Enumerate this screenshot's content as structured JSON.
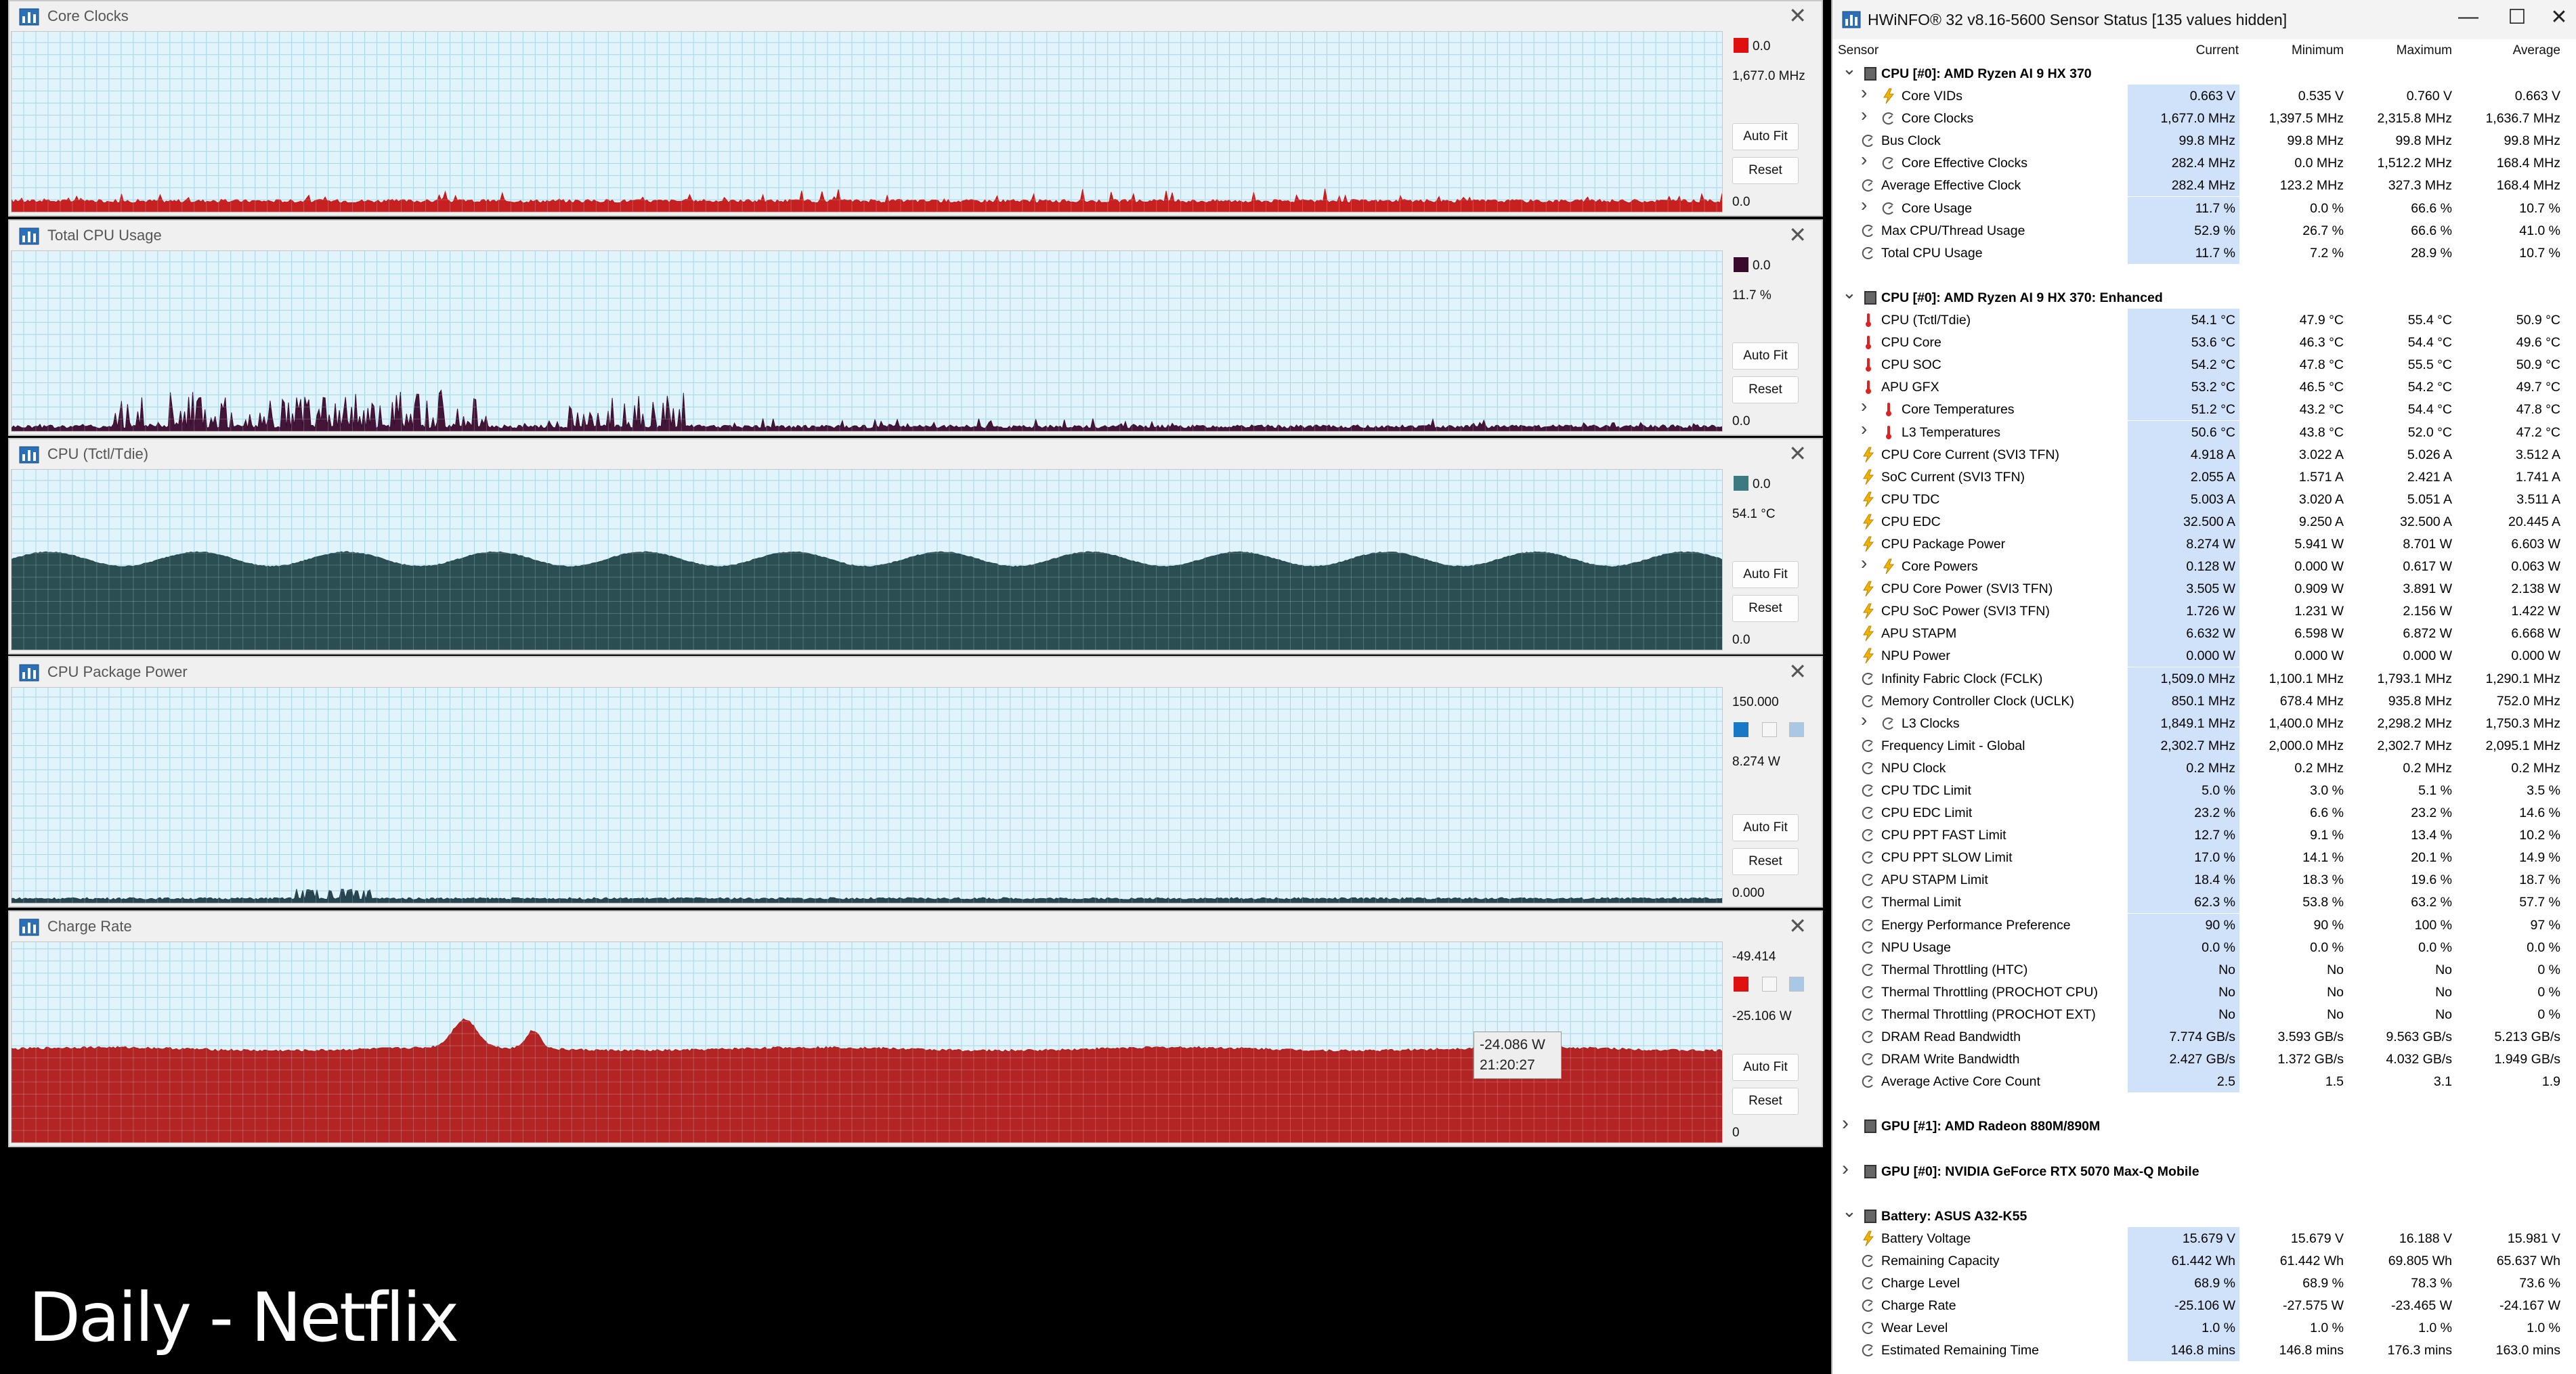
{
  "graphs": [
    {
      "id": "core-clocks",
      "title": "Core Clocks",
      "top_label": "0.0",
      "value_label": "1,677.0 MHz",
      "bottom_label": "0.0",
      "color": "#c41414",
      "swatch_color": "#e01010",
      "series_level": 0.055,
      "pattern": "spiky"
    },
    {
      "id": "total-cpu-usage",
      "title": "Total CPU Usage",
      "top_label": "0.0",
      "value_label": "11.7 %",
      "bottom_label": "0.0",
      "color": "#3a0a2e",
      "swatch_color": "#3a0a2e",
      "series_level": 0.03,
      "pattern": "usage"
    },
    {
      "id": "cpu-tctl",
      "title": "CPU (Tctl/Tdie)",
      "top_label": "0.0",
      "value_label": "54.1 °C",
      "bottom_label": "0.0",
      "color": "#21454a",
      "swatch_color": "#3a7a80",
      "series_level": 0.5,
      "pattern": "wave"
    },
    {
      "id": "cpu-package-power",
      "title": "CPU Package Power",
      "top_label": "150.000",
      "value_label": "8.274 W",
      "bottom_label": "0.000",
      "color": "#1e3a48",
      "swatch_color": "#1878c8",
      "series_level": 0.02,
      "pattern": "flat"
    },
    {
      "id": "charge-rate",
      "title": "Charge Rate",
      "top_label": "-49.414",
      "value_label": "-25.106 W",
      "bottom_label": "0",
      "color": "#b01818",
      "swatch_color": "#e01010",
      "series_level": 0.48,
      "pattern": "charge"
    }
  ],
  "graph_buttons": {
    "autofit": "Auto Fit",
    "reset": "Reset"
  },
  "tooltip": {
    "value": "-24.086 W",
    "time": "21:20:27"
  },
  "overlay_title": "Daily - Netflix",
  "sensor_window": {
    "title": "HWiNFO® 32 v8.16-5600 Sensor Status [135 values hidden]",
    "columns": {
      "sensor": "Sensor",
      "current": "Current",
      "minimum": "Minimum",
      "maximum": "Maximum",
      "average": "Average"
    },
    "rows": [
      {
        "type": "group",
        "name": "CPU [#0]: AMD Ryzen AI 9 HX 370",
        "expanded": true
      },
      {
        "type": "item",
        "icon": "bolt",
        "expand": true,
        "name": "Core VIDs",
        "cur": "0.663 V",
        "min": "0.535 V",
        "max": "0.760 V",
        "avg": "0.663 V"
      },
      {
        "type": "item",
        "icon": "clock",
        "expand": true,
        "name": "Core Clocks",
        "cur": "1,677.0 MHz",
        "min": "1,397.5 MHz",
        "max": "2,315.8 MHz",
        "avg": "1,636.7 MHz"
      },
      {
        "type": "item",
        "icon": "none",
        "expand": false,
        "name": "Bus Clock",
        "cur": "99.8 MHz",
        "min": "99.8 MHz",
        "max": "99.8 MHz",
        "avg": "99.8 MHz"
      },
      {
        "type": "item",
        "icon": "clock",
        "expand": true,
        "name": "Core Effective Clocks",
        "cur": "282.4 MHz",
        "min": "0.0 MHz",
        "max": "1,512.2 MHz",
        "avg": "168.4 MHz"
      },
      {
        "type": "item",
        "icon": "none",
        "expand": false,
        "name": "Average Effective Clock",
        "cur": "282.4 MHz",
        "min": "123.2 MHz",
        "max": "327.3 MHz",
        "avg": "168.4 MHz"
      },
      {
        "type": "item",
        "icon": "clock",
        "expand": true,
        "name": "Core Usage",
        "cur": "11.7 %",
        "min": "0.0 %",
        "max": "66.6 %",
        "avg": "10.7 %"
      },
      {
        "type": "item",
        "icon": "clock",
        "expand": false,
        "name": "Max CPU/Thread Usage",
        "cur": "52.9 %",
        "min": "26.7 %",
        "max": "66.6 %",
        "avg": "41.0 %"
      },
      {
        "type": "item",
        "icon": "clock",
        "expand": false,
        "name": "Total CPU Usage",
        "cur": "11.7 %",
        "min": "7.2 %",
        "max": "28.9 %",
        "avg": "10.7 %"
      },
      {
        "type": "spacer"
      },
      {
        "type": "group",
        "name": "CPU [#0]: AMD Ryzen AI 9 HX 370: Enhanced",
        "expanded": true
      },
      {
        "type": "item",
        "icon": "temp",
        "expand": false,
        "name": "CPU (Tctl/Tdie)",
        "cur": "54.1 °C",
        "min": "47.9 °C",
        "max": "55.4 °C",
        "avg": "50.9 °C"
      },
      {
        "type": "item",
        "icon": "temp",
        "expand": false,
        "name": "CPU Core",
        "cur": "53.6 °C",
        "min": "46.3 °C",
        "max": "54.4 °C",
        "avg": "49.6 °C"
      },
      {
        "type": "item",
        "icon": "temp",
        "expand": false,
        "name": "CPU SOC",
        "cur": "54.2 °C",
        "min": "47.8 °C",
        "max": "55.5 °C",
        "avg": "50.9 °C"
      },
      {
        "type": "item",
        "icon": "temp",
        "expand": false,
        "name": "APU GFX",
        "cur": "53.2 °C",
        "min": "46.5 °C",
        "max": "54.2 °C",
        "avg": "49.7 °C"
      },
      {
        "type": "item",
        "icon": "temp",
        "expand": true,
        "name": "Core Temperatures",
        "cur": "51.2 °C",
        "min": "43.2 °C",
        "max": "54.4 °C",
        "avg": "47.8 °C"
      },
      {
        "type": "item",
        "icon": "temp",
        "expand": true,
        "name": "L3 Temperatures",
        "cur": "50.6 °C",
        "min": "43.8 °C",
        "max": "52.0 °C",
        "avg": "47.2 °C"
      },
      {
        "type": "item",
        "icon": "bolt",
        "expand": false,
        "name": "CPU Core Current (SVI3 TFN)",
        "cur": "4.918 A",
        "min": "3.022 A",
        "max": "5.026 A",
        "avg": "3.512 A"
      },
      {
        "type": "item",
        "icon": "bolt",
        "expand": false,
        "name": "SoC Current (SVI3 TFN)",
        "cur": "2.055 A",
        "min": "1.571 A",
        "max": "2.421 A",
        "avg": "1.741 A"
      },
      {
        "type": "item",
        "icon": "bolt",
        "expand": false,
        "name": "CPU TDC",
        "cur": "5.003 A",
        "min": "3.020 A",
        "max": "5.051 A",
        "avg": "3.511 A"
      },
      {
        "type": "item",
        "icon": "bolt",
        "expand": false,
        "name": "CPU EDC",
        "cur": "32.500 A",
        "min": "9.250 A",
        "max": "32.500 A",
        "avg": "20.445 A"
      },
      {
        "type": "item",
        "icon": "bolt",
        "expand": false,
        "name": "CPU Package Power",
        "cur": "8.274 W",
        "min": "5.941 W",
        "max": "8.701 W",
        "avg": "6.603 W"
      },
      {
        "type": "item",
        "icon": "bolt",
        "expand": true,
        "name": "Core Powers",
        "cur": "0.128 W",
        "min": "0.000 W",
        "max": "0.617 W",
        "avg": "0.063 W"
      },
      {
        "type": "item",
        "icon": "bolt",
        "expand": false,
        "name": "CPU Core Power (SVI3 TFN)",
        "cur": "3.505 W",
        "min": "0.909 W",
        "max": "3.891 W",
        "avg": "2.138 W"
      },
      {
        "type": "item",
        "icon": "bolt",
        "expand": false,
        "name": "CPU SoC Power (SVI3 TFN)",
        "cur": "1.726 W",
        "min": "1.231 W",
        "max": "2.156 W",
        "avg": "1.422 W"
      },
      {
        "type": "item",
        "icon": "bolt",
        "expand": false,
        "name": "APU STAPM",
        "cur": "6.632 W",
        "min": "6.598 W",
        "max": "6.872 W",
        "avg": "6.668 W"
      },
      {
        "type": "item",
        "icon": "bolt",
        "expand": false,
        "name": "NPU Power",
        "cur": "0.000 W",
        "min": "0.000 W",
        "max": "0.000 W",
        "avg": "0.000 W"
      },
      {
        "type": "item",
        "icon": "clock",
        "expand": false,
        "name": "Infinity Fabric Clock (FCLK)",
        "cur": "1,509.0 MHz",
        "min": "1,100.1 MHz",
        "max": "1,793.1 MHz",
        "avg": "1,290.1 MHz"
      },
      {
        "type": "item",
        "icon": "clock",
        "expand": false,
        "name": "Memory Controller Clock (UCLK)",
        "cur": "850.1 MHz",
        "min": "678.4 MHz",
        "max": "935.8 MHz",
        "avg": "752.0 MHz"
      },
      {
        "type": "item",
        "icon": "clock",
        "expand": true,
        "name": "L3 Clocks",
        "cur": "1,849.1 MHz",
        "min": "1,400.0 MHz",
        "max": "2,298.2 MHz",
        "avg": "1,750.3 MHz"
      },
      {
        "type": "item",
        "icon": "clock",
        "expand": false,
        "name": "Frequency Limit - Global",
        "cur": "2,302.7 MHz",
        "min": "2,000.0 MHz",
        "max": "2,302.7 MHz",
        "avg": "2,095.1 MHz"
      },
      {
        "type": "item",
        "icon": "clock",
        "expand": false,
        "name": "NPU Clock",
        "cur": "0.2 MHz",
        "min": "0.2 MHz",
        "max": "0.2 MHz",
        "avg": "0.2 MHz"
      },
      {
        "type": "item",
        "icon": "clock",
        "expand": false,
        "name": "CPU TDC Limit",
        "cur": "5.0 %",
        "min": "3.0 %",
        "max": "5.1 %",
        "avg": "3.5 %"
      },
      {
        "type": "item",
        "icon": "clock",
        "expand": false,
        "name": "CPU EDC Limit",
        "cur": "23.2 %",
        "min": "6.6 %",
        "max": "23.2 %",
        "avg": "14.6 %"
      },
      {
        "type": "item",
        "icon": "clock",
        "expand": false,
        "name": "CPU PPT FAST Limit",
        "cur": "12.7 %",
        "min": "9.1 %",
        "max": "13.4 %",
        "avg": "10.2 %"
      },
      {
        "type": "item",
        "icon": "clock",
        "expand": false,
        "name": "CPU PPT SLOW Limit",
        "cur": "17.0 %",
        "min": "14.1 %",
        "max": "20.1 %",
        "avg": "14.9 %"
      },
      {
        "type": "item",
        "icon": "clock",
        "expand": false,
        "name": "APU STAPM Limit",
        "cur": "18.4 %",
        "min": "18.3 %",
        "max": "19.6 %",
        "avg": "18.7 %"
      },
      {
        "type": "item",
        "icon": "clock",
        "expand": false,
        "name": "Thermal Limit",
        "cur": "62.3 %",
        "min": "53.8 %",
        "max": "63.2 %",
        "avg": "57.7 %"
      },
      {
        "type": "item",
        "icon": "clock",
        "expand": false,
        "name": "Energy Performance Preference",
        "cur": "90 %",
        "min": "90 %",
        "max": "100 %",
        "avg": "97 %"
      },
      {
        "type": "item",
        "icon": "clock",
        "expand": false,
        "name": "NPU Usage",
        "cur": "0.0 %",
        "min": "0.0 %",
        "max": "0.0 %",
        "avg": "0.0 %"
      },
      {
        "type": "item",
        "icon": "clock",
        "expand": false,
        "name": "Thermal Throttling (HTC)",
        "cur": "No",
        "min": "No",
        "max": "No",
        "avg": "0 %"
      },
      {
        "type": "item",
        "icon": "clock",
        "expand": false,
        "name": "Thermal Throttling (PROCHOT CPU)",
        "cur": "No",
        "min": "No",
        "max": "No",
        "avg": "0 %"
      },
      {
        "type": "item",
        "icon": "clock",
        "expand": false,
        "name": "Thermal Throttling (PROCHOT EXT)",
        "cur": "No",
        "min": "No",
        "max": "No",
        "avg": "0 %"
      },
      {
        "type": "item",
        "icon": "clock",
        "expand": false,
        "name": "DRAM Read Bandwidth",
        "cur": "7.774 GB/s",
        "min": "3.593 GB/s",
        "max": "9.563 GB/s",
        "avg": "5.213 GB/s"
      },
      {
        "type": "item",
        "icon": "clock",
        "expand": false,
        "name": "DRAM Write Bandwidth",
        "cur": "2.427 GB/s",
        "min": "1.372 GB/s",
        "max": "4.032 GB/s",
        "avg": "1.949 GB/s"
      },
      {
        "type": "item",
        "icon": "clock",
        "expand": false,
        "name": "Average Active Core Count",
        "cur": "2.5",
        "min": "1.5",
        "max": "3.1",
        "avg": "1.9"
      },
      {
        "type": "spacer"
      },
      {
        "type": "group",
        "name": "GPU [#1]: AMD Radeon 880M/890M",
        "expanded": false
      },
      {
        "type": "spacer"
      },
      {
        "type": "group",
        "name": "GPU [#0]: NVIDIA  GeForce RTX 5070 Max-Q Mobile",
        "expanded": false
      },
      {
        "type": "spacer"
      },
      {
        "type": "group",
        "name": "Battery: ASUS  A32-K55",
        "expanded": true
      },
      {
        "type": "item",
        "icon": "bolt",
        "expand": false,
        "name": "Battery Voltage",
        "cur": "15.679 V",
        "min": "15.679 V",
        "max": "16.188 V",
        "avg": "15.981 V"
      },
      {
        "type": "item",
        "icon": "clock",
        "expand": false,
        "name": "Remaining Capacity",
        "cur": "61.442 Wh",
        "min": "61.442 Wh",
        "max": "69.805 Wh",
        "avg": "65.637 Wh"
      },
      {
        "type": "item",
        "icon": "clock",
        "expand": false,
        "name": "Charge Level",
        "cur": "68.9 %",
        "min": "68.9 %",
        "max": "78.3 %",
        "avg": "73.6 %"
      },
      {
        "type": "item",
        "icon": "clock",
        "expand": false,
        "name": "Charge Rate",
        "cur": "-25.106 W",
        "min": "-27.575 W",
        "max": "-23.465 W",
        "avg": "-24.167 W"
      },
      {
        "type": "item",
        "icon": "clock",
        "expand": false,
        "name": "Wear Level",
        "cur": "1.0 %",
        "min": "1.0 %",
        "max": "1.0 %",
        "avg": "1.0 %"
      },
      {
        "type": "item",
        "icon": "clock",
        "expand": false,
        "name": "Estimated Remaining Time",
        "cur": "146.8 mins",
        "min": "146.8 mins",
        "max": "176.3 mins",
        "avg": "163.0 mins"
      }
    ]
  }
}
